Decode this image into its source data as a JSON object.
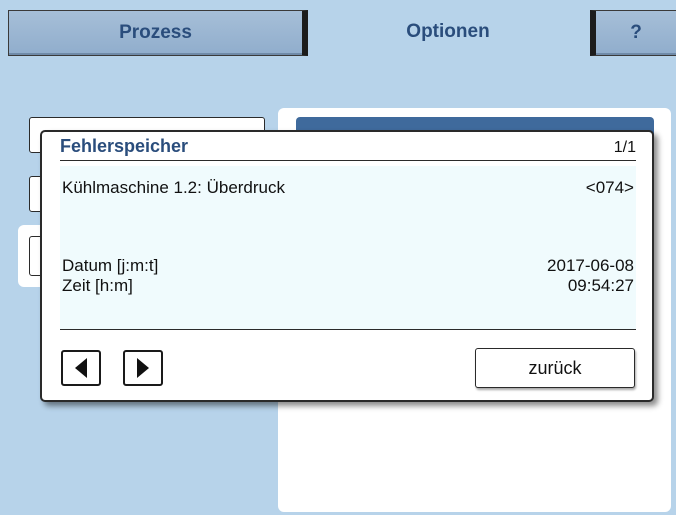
{
  "tabs": [
    {
      "label": "Prozess",
      "active": false
    },
    {
      "label": "Optionen",
      "active": true
    },
    {
      "label": "?",
      "active": false
    }
  ],
  "dialog": {
    "title": "Fehlerspeicher",
    "page": "1/1",
    "error_label": "Kühlmaschine 1.2: Überdruck",
    "error_code": "<074>",
    "date_label": "Datum [j:m:t]",
    "date_value": "2017-06-08",
    "time_label": "Zeit [h:m]",
    "time_value": "09:54:27",
    "prev_icon": "triangle-left-icon",
    "next_icon": "triangle-right-icon",
    "back_label": "zurück"
  },
  "colors": {
    "background": "#b7d3ea",
    "accent_text": "#2a4d7c",
    "panel_header": "#3f6a9c",
    "dialog_body": "#f0fbfd"
  }
}
